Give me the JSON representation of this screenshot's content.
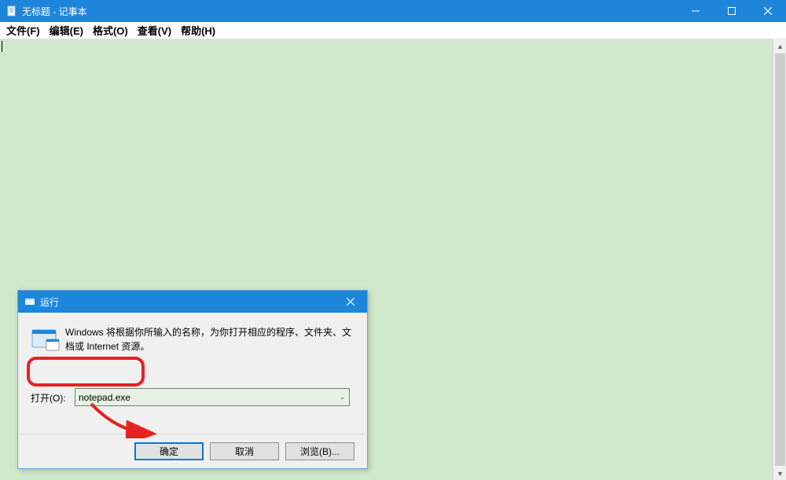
{
  "notepad": {
    "title": "无标题 - 记事本",
    "menu": {
      "file": "文件(F)",
      "edit": "编辑(E)",
      "format": "格式(O)",
      "view": "查看(V)",
      "help": "帮助(H)"
    }
  },
  "run": {
    "title": "运行",
    "description": "Windows 将根据你所输入的名称，为你打开相应的程序、文件夹、文档或 Internet 资源。",
    "open_label": "打开(O):",
    "input_value": "notepad.exe",
    "buttons": {
      "ok": "确定",
      "cancel": "取消",
      "browse": "浏览(B)..."
    }
  },
  "colors": {
    "titlebar": "#1e86da",
    "notepad_bg": "#d0e8cb",
    "annotation": "#e62222"
  }
}
